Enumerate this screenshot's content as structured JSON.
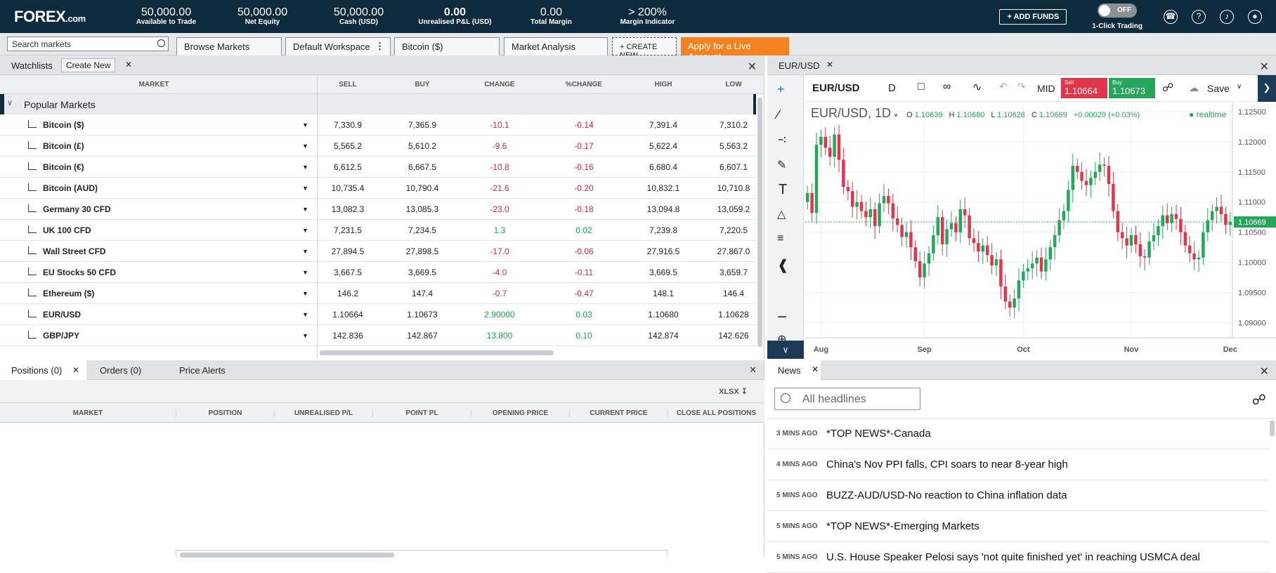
{
  "header": {
    "logo": "FOREX",
    "logo_suffix": ".com",
    "stats": [
      {
        "value": "50,000.00",
        "label": "Available to Trade",
        "bold": false
      },
      {
        "value": "50,000.00",
        "label": "Net Equity",
        "bold": false
      },
      {
        "value": "50,000.00",
        "label": "Cash (USD)",
        "bold": false
      },
      {
        "value": "0.00",
        "label": "Unrealised P&L (USD)",
        "bold": true
      },
      {
        "value": "0.00",
        "label": "Total Margin",
        "bold": false
      },
      {
        "value": "> 200%",
        "label": "Margin Indicator",
        "bold": false
      }
    ],
    "add_funds": "+ ADD FUNDS",
    "one_click_toggle": "OFF",
    "one_click_label": "1-Click Trading"
  },
  "toolbar": {
    "search_placeholder": "Search markets",
    "tabs": [
      "Browse Markets",
      "Default Workspace",
      "Bitcoin ($)",
      "Market Analysis"
    ],
    "create_new": "+ CREATE NEW",
    "live_account": "Apply for a Live Account"
  },
  "watchlist": {
    "title": "Watchlists",
    "create_new": "Create New",
    "columns": [
      "MARKET",
      "SELL",
      "BUY",
      "CHANGE",
      "%CHANGE",
      "HIGH",
      "LOW"
    ],
    "group": "Popular Markets",
    "rows": [
      {
        "name": "Bitcoin ($)",
        "sell": "7,330.9",
        "buy": "7,365.9",
        "change": "-10.1",
        "pct": "-0.14",
        "high": "7,391.4",
        "low": "7,310.2",
        "dir": "neg"
      },
      {
        "name": "Bitcoin (£)",
        "sell": "5,565.2",
        "buy": "5,610.2",
        "change": "-9.6",
        "pct": "-0.17",
        "high": "5,622.4",
        "low": "5,563.2",
        "dir": "neg"
      },
      {
        "name": "Bitcoin (€)",
        "sell": "6,612.5",
        "buy": "6,667.5",
        "change": "-10.8",
        "pct": "-0.16",
        "high": "6,680.4",
        "low": "6,607.1",
        "dir": "neg"
      },
      {
        "name": "Bitcoin (AUD)",
        "sell": "10,735.4",
        "buy": "10,790.4",
        "change": "-21.6",
        "pct": "-0.20",
        "high": "10,832.1",
        "low": "10,710.8",
        "dir": "neg"
      },
      {
        "name": "Germany 30 CFD",
        "sell": "13,082.3",
        "buy": "13,085.3",
        "change": "-23.0",
        "pct": "-0.18",
        "high": "13,094.8",
        "low": "13,059.2",
        "dir": "neg"
      },
      {
        "name": "UK 100 CFD",
        "sell": "7,231.5",
        "buy": "7,234.5",
        "change": "1.3",
        "pct": "0.02",
        "high": "7,239.8",
        "low": "7,220.5",
        "dir": "pos"
      },
      {
        "name": "Wall Street CFD",
        "sell": "27,894.5",
        "buy": "27,898.5",
        "change": "-17.0",
        "pct": "-0.06",
        "high": "27,916.5",
        "low": "27,867.0",
        "dir": "neg"
      },
      {
        "name": "EU Stocks 50 CFD",
        "sell": "3,667.5",
        "buy": "3,669.5",
        "change": "-4.0",
        "pct": "-0.11",
        "high": "3,669.5",
        "low": "3,659.7",
        "dir": "neg"
      },
      {
        "name": "Ethereum ($)",
        "sell": "146.2",
        "buy": "147.4",
        "change": "-0.7",
        "pct": "-0.47",
        "high": "148.1",
        "low": "146.4",
        "dir": "neg"
      },
      {
        "name": "EUR/USD",
        "sell": "1.10664",
        "buy": "1.10673",
        "change": "2.90000",
        "pct": "0.03",
        "high": "1.10680",
        "low": "1.10628",
        "dir": "pos"
      },
      {
        "name": "GBP/JPY",
        "sell": "142.836",
        "buy": "142.867",
        "change": "13.800",
        "pct": "0.10",
        "high": "142.874",
        "low": "142.626",
        "dir": "pos"
      }
    ]
  },
  "chart_panel": {
    "tab": "EUR/USD",
    "symbol": "EUR/USD",
    "interval": "D",
    "mid": "MID",
    "sell_label": "Sell",
    "sell_price": "1.10664",
    "buy_label": "Buy",
    "buy_price": "1.10673",
    "save": "Save",
    "legend_title": "EUR/USD, 1D",
    "ohlc": {
      "o_label": "O",
      "o": "1.10639",
      "h_label": "H",
      "h": "1.10680",
      "l_label": "L",
      "l": "1.10628",
      "c_label": "C",
      "c": "1.10669",
      "chg": "+0.00029 (+0.03%)"
    },
    "realtime": "realtime",
    "last_price_label": "1.10669",
    "colors": {
      "up": "#26a65b",
      "down": "#e0364c"
    }
  },
  "chart_data": {
    "type": "candlestick",
    "ylim": [
      1.0875,
      1.1265
    ],
    "yticks": [
      1.09,
      1.095,
      1.1,
      1.105,
      1.11,
      1.115,
      1.12,
      1.125
    ],
    "ytick_labels": [
      "1.09000",
      "1.09500",
      "1.10000",
      "1.10500",
      "1.11000",
      "1.11500",
      "1.12000",
      "1.12500"
    ],
    "xticks": [
      "Aug",
      "Sep",
      "Oct",
      "Nov",
      "Dec"
    ],
    "xtick_index": [
      3,
      26,
      48,
      72,
      94
    ],
    "last": 1.10669,
    "closes": [
      1.1115,
      1.1082,
      1.1195,
      1.1208,
      1.119,
      1.1175,
      1.1212,
      1.117,
      1.1125,
      1.1118,
      1.1092,
      1.11,
      1.1085,
      1.1075,
      1.1088,
      1.106,
      1.1098,
      1.111,
      1.1098,
      1.1073,
      1.1062,
      1.1042,
      1.105,
      1.1025,
      1.1002,
      1.0975,
      1.0998,
      1.1015,
      1.1045,
      1.1075,
      1.103,
      1.1055,
      1.1065,
      1.105,
      1.1088,
      1.1078,
      1.104,
      1.1032,
      1.1018,
      1.1028,
      1.1012,
      1.0995,
      1.1005,
      1.096,
      1.0935,
      1.0925,
      1.094,
      1.097,
      1.0985,
      1.099,
      1.0998,
      1.1008,
      1.0985,
      1.1005,
      1.1025,
      1.1045,
      1.107,
      1.1085,
      1.112,
      1.116,
      1.115,
      1.1135,
      1.1128,
      1.114,
      1.115,
      1.1162,
      1.116,
      1.113,
      1.1085,
      1.105,
      1.104,
      1.1028,
      1.1045,
      1.103,
      1.101,
      1.1008,
      1.1035,
      1.1045,
      1.106,
      1.1078,
      1.1065,
      1.108,
      1.1072,
      1.105,
      1.1028,
      1.1015,
      1.1005,
      1.1008,
      1.105,
      1.107,
      1.1085,
      1.1092,
      1.108,
      1.1062,
      1.1067
    ]
  },
  "positions": {
    "tabs": [
      "Positions (0)",
      "Orders (0)",
      "Price Alerts"
    ],
    "xlsx": "XLSX",
    "columns": [
      "MARKET",
      "POSITION",
      "UNREALISED P/L",
      "POINT PL",
      "OPENING PRICE",
      "CURRENT PRICE",
      "CLOSE ALL POSITIONS"
    ]
  },
  "news": {
    "tab": "News",
    "search_placeholder": "All headlines",
    "items": [
      {
        "time": "3 MINS AGO",
        "headline": "*TOP NEWS*-Canada"
      },
      {
        "time": "4 MINS AGO",
        "headline": "China's Nov PPI falls, CPI soars to near 8-year high"
      },
      {
        "time": "5 MINS AGO",
        "headline": "BUZZ-AUD/USD-No reaction to China inflation data"
      },
      {
        "time": "5 MINS AGO",
        "headline": "*TOP NEWS*-Emerging Markets"
      },
      {
        "time": "5 MINS AGO",
        "headline": "U.S. House Speaker Pelosi says 'not quite finished yet' in reaching USMCA deal"
      }
    ]
  }
}
